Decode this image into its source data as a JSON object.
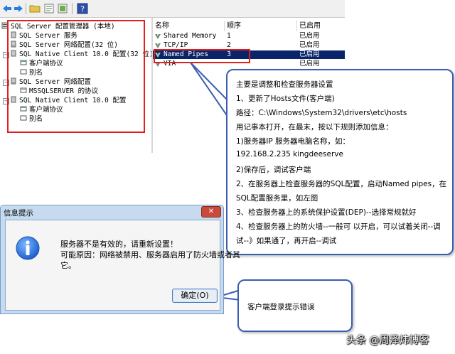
{
  "toolbar": {
    "icons": [
      "back-arrow-icon",
      "forward-arrow-icon",
      "folder-icon",
      "properties-icon",
      "export-icon",
      "help-icon"
    ]
  },
  "tree": {
    "root": "SQL Server 配置管理器 (本地)",
    "services": "SQL Server 服务",
    "netconfig32": "SQL Server 网络配置(32 位)",
    "native32": "SQL Native Client 10.0 配置(32 位)",
    "client_protocols_32": "客户端协议",
    "alias_32": "别名",
    "netconfig": "SQL Server 网络配置",
    "mssqlserver": "MSSQLSERVER 的协议",
    "native": "SQL Native Client 10.0 配置",
    "client_protocols": "客户端协议",
    "alias": "别名"
  },
  "list": {
    "headers": {
      "name": "名称",
      "order": "顺序",
      "status": "已启用"
    },
    "rows": [
      {
        "name": "Shared Memory",
        "order": "1",
        "status": "已启用"
      },
      {
        "name": "TCP/IP",
        "order": "2",
        "status": "已启用"
      },
      {
        "name": "Named Pipes",
        "order": "3",
        "status": "已启用"
      },
      {
        "name": "VIA",
        "order": "",
        "status": "已启用"
      }
    ]
  },
  "callout_main": {
    "lines": [
      "主要是调整和检查服务器设置",
      "1、更新了Hosts文件(客户端)",
      "路径：C:\\Windows\\System32\\drivers\\etc\\hosts",
      "用记事本打开，在最末，按以下规则添加信息：",
      "1)服务器IP  服务器电脑名称，如：",
      "192.168.2.235 kingdeeserve",
      "2)保存后，调试客户端",
      "2、在服务器上检查服务器的SQL配置，启动Named pipes，在",
      "SQL配置服务里，如左图",
      "3、检查服务器上的系统保护设置(DEP)--选择常规就好",
      "4、检查服务器上的防火墙--一般可 以开启，可以试着关闭--调",
      "试--》如果通了，再开启--调试"
    ]
  },
  "callout_error": {
    "text": "客户端登录提示错误"
  },
  "dialog": {
    "title": "信息提示",
    "close_label": "✕",
    "message_line1": "服务器不是有效的，请重新设置！",
    "message_line2": "可能原因：网络被禁用、服务器启用了防火墙或者其",
    "message_line3": "它。",
    "ok_label": "确定(O)"
  },
  "watermark": "头条 @周泽炜博客",
  "colors": {
    "highlight_red": "#e02020",
    "selection": "#0a246a",
    "callout_border": "#3a5fb0",
    "dialog_frame": "#c6daf0"
  }
}
